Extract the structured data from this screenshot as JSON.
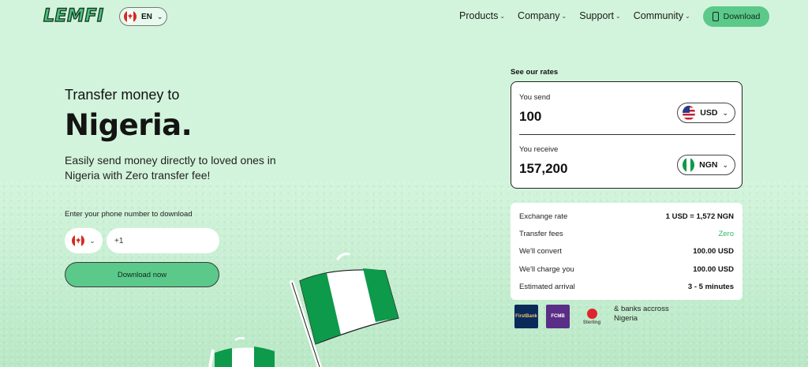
{
  "header": {
    "logo": "LEMFI",
    "language": "EN",
    "nav": [
      {
        "label": "Products"
      },
      {
        "label": "Company"
      },
      {
        "label": "Support"
      },
      {
        "label": "Community"
      }
    ],
    "download_label": "Download"
  },
  "hero": {
    "subtitle": "Transfer money to",
    "title": "Nigeria.",
    "description": "Easily send money directly to loved ones in Nigeria with Zero transfer fee!"
  },
  "phone": {
    "label": "Enter your phone number to download",
    "country_code": "+1",
    "button_label": "Download now"
  },
  "rates": {
    "heading": "See our rates",
    "send_label": "You send",
    "send_value": "100",
    "send_currency": "USD",
    "receive_label": "You receive",
    "receive_value": "157,200",
    "receive_currency": "NGN"
  },
  "details": [
    {
      "key": "Exchange rate",
      "value": "1 USD = 1,572 NGN"
    },
    {
      "key": "Transfer fees",
      "value": "Zero"
    },
    {
      "key": "We'll convert",
      "value": "100.00 USD"
    },
    {
      "key": "We'll charge you",
      "value": "100.00 USD"
    },
    {
      "key": "Estimated arrival",
      "value": "3 - 5 minutes"
    }
  ],
  "banks": {
    "logos": [
      "FirstBank",
      "FCMB",
      "Sterling"
    ],
    "text": "& banks accross Nigeria"
  },
  "colors": {
    "background": "#d3f4dc",
    "accent": "#5bc98a",
    "zero_fee": "#2eb86a"
  }
}
